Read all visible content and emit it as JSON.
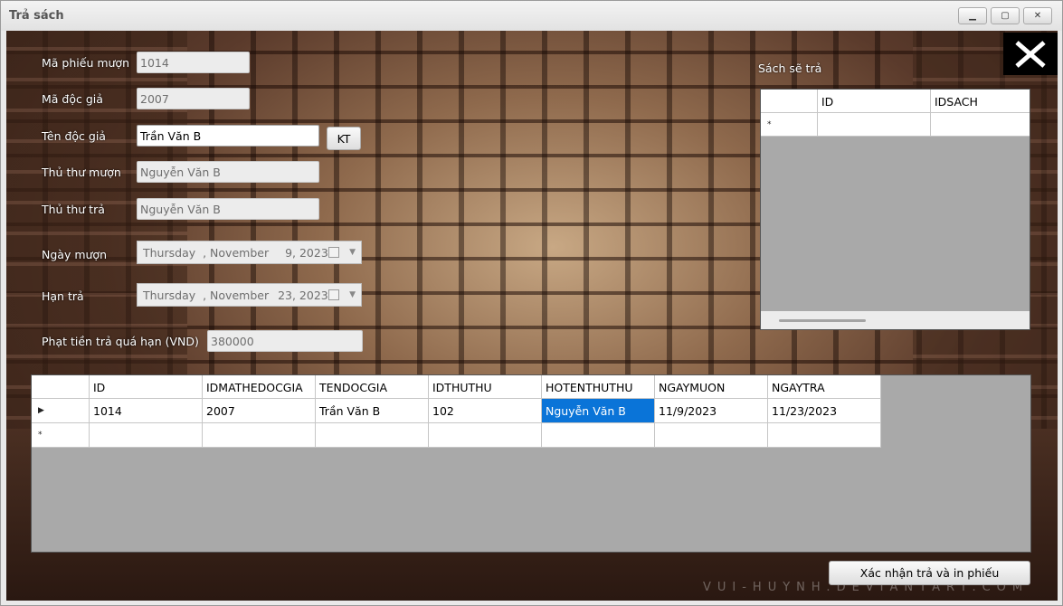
{
  "window": {
    "title": "Trả sách"
  },
  "form": {
    "ma_phieu_muon": {
      "label": "Mã phiếu mượn",
      "value": "1014"
    },
    "ma_doc_gia": {
      "label": "Mã độc giả",
      "value": "2007"
    },
    "ten_doc_gia": {
      "label": "Tên độc giả",
      "value": "Trần Văn B"
    },
    "kt_button": "KT",
    "thu_thu_muon": {
      "label": "Thủ thư mượn",
      "value": "Nguyễn Văn B"
    },
    "thu_thu_tra": {
      "label": "Thủ thư trả",
      "value": "Nguyễn Văn B"
    },
    "ngay_muon": {
      "label": "Ngày mượn",
      "day": "Thursday",
      "month": ", November",
      "date": "9, 2023"
    },
    "han_tra": {
      "label": "Hạn trả",
      "day": "Thursday",
      "month": ", November",
      "date": "23, 2023"
    },
    "phat_tien": {
      "label": "Phạt tiền trả quá hạn (VND)",
      "value": "380000"
    }
  },
  "books_panel": {
    "label": "Sách sẽ trả",
    "columns": [
      "ID",
      "IDSACH"
    ],
    "new_row_marker": "*"
  },
  "main_grid": {
    "columns": [
      "ID",
      "IDMATHEDOCGIA",
      "TENDOCGIA",
      "IDTHUTHU",
      "HOTENTHUTHU",
      "NGAYMUON",
      "NGAYTRA"
    ],
    "rows": [
      [
        "1014",
        "2007",
        "Trần Văn B",
        "102",
        "Nguyễn Văn B",
        "11/9/2023",
        "11/23/2023"
      ]
    ],
    "current_row_marker": "▶",
    "new_row_marker": "*"
  },
  "confirm_button": "Xác nhận trả và in phiếu",
  "watermark": "VUI-HUYNH.DEVIANTART.COM",
  "icons": {
    "minimize": "minimize-icon",
    "maximize": "maximize-icon",
    "close": "close-icon",
    "close_big": "close-x-icon"
  }
}
